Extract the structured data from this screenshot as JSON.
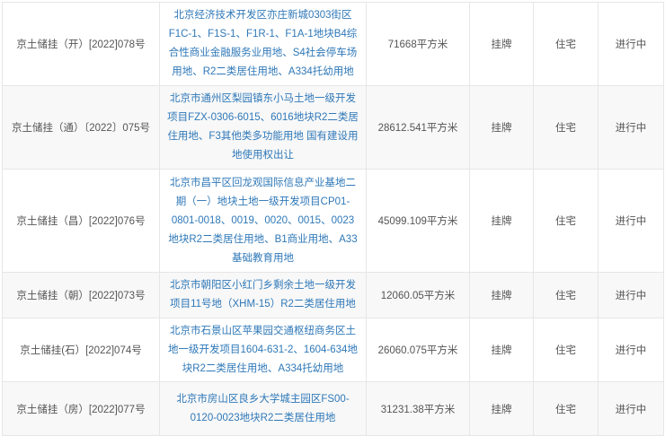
{
  "rows": [
    {
      "code": "京土储挂（开）[2022]078号",
      "desc": "北京经济技术开发区亦庄新城0303街区F1C-1、F1S-1、F1R-1、F1A-1地块B4综合性商业金融服务业用地、S4社会停车场用地、R2二类居住用地、A334托幼用地",
      "area": "71668平方米",
      "method": "挂牌",
      "use": "住宅",
      "status": "进行中"
    },
    {
      "code": "京土储挂（通）〔2022〕075号",
      "desc": "北京市通州区梨园镇东小马土地一级开发项目FZX-0306-6015、6016地块R2二类居住用地、F3其他类多功能用地 国有建设用地使用权出让",
      "area": "28612.541平方米",
      "method": "挂牌",
      "use": "住宅",
      "status": "进行中"
    },
    {
      "code": "京土储挂（昌）[2022]076号",
      "desc": "北京市昌平区回龙观国际信息产业基地二期（一）地块土地一级开发项目CP01-0801-0018、0019、0020、0015、0023地块R2二类居住用地、B1商业用地、A33基础教育用地",
      "area": "45099.109平方米",
      "method": "挂牌",
      "use": "住宅",
      "status": "进行中"
    },
    {
      "code": "京土储挂（朝）[2022]073号",
      "desc": "北京市朝阳区小红门乡剩余土地一级开发项目11号地（XHM-15）R2二类居住用地",
      "area": "12060.05平方米",
      "method": "挂牌",
      "use": "住宅",
      "status": "进行中"
    },
    {
      "code": "京土储挂(石）[2022]074号",
      "desc": "北京市石景山区苹果园交通枢纽商务区土地一级开发项目1604-631-2、1604-634地块R2二类居住用地、A334托幼用地",
      "area": "26060.075平方米",
      "method": "挂牌",
      "use": "住宅",
      "status": "进行中"
    },
    {
      "code": "京土储挂（房）[2022]077号",
      "desc": "北京市房山区良乡大学城主园区FS00-0120-0023地块R2二类居住用地",
      "area": "31231.38平方米",
      "method": "挂牌",
      "use": "住宅",
      "status": "进行中"
    }
  ]
}
